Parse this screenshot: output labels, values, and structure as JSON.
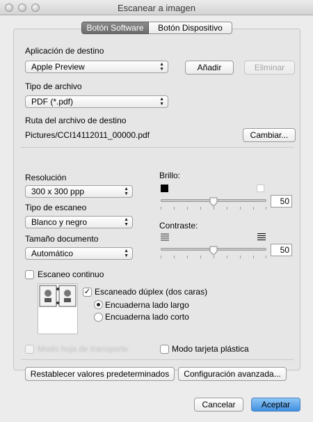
{
  "window": {
    "title": "Escanear a imagen"
  },
  "tabs": {
    "software": "Botón Software",
    "device": "Botón Dispositivo"
  },
  "destination": {
    "label": "Aplicación de destino",
    "value": "Apple Preview",
    "add_label": "Añadir",
    "remove_label": "Eliminar"
  },
  "file_type": {
    "label": "Tipo de archivo",
    "value": "PDF (*.pdf)"
  },
  "path": {
    "label": "Ruta del archivo de destino",
    "value": "Pictures/CCI14112011_00000.pdf",
    "change_label": "Cambiar..."
  },
  "resolution": {
    "label": "Resolución",
    "value": "300 x 300 ppp"
  },
  "scan_type": {
    "label": "Tipo de escaneo",
    "value": "Blanco y negro"
  },
  "doc_size": {
    "label": "Tamaño documento",
    "value": "Automático"
  },
  "brightness": {
    "label": "Brillo:",
    "value": "50",
    "level": 0.5
  },
  "contrast": {
    "label": "Contraste:",
    "value": "50",
    "level": 0.5
  },
  "continuous": {
    "label": "Escaneo continuo",
    "checked": false
  },
  "duplex": {
    "label": "Escaneado dúplex (dos caras)",
    "checked": true,
    "long_edge": "Encuaderna lado largo",
    "short_edge": "Encuaderna lado corto",
    "selected": "long_edge"
  },
  "carrier": {
    "label": "Modo hoja de transporte",
    "checked": false,
    "enabled": false
  },
  "plastic_card": {
    "label": "Modo tarjeta plástica",
    "checked": false
  },
  "footer": {
    "reset_label": "Restablecer valores predeterminados",
    "advanced_label": "Configuración avanzada...",
    "cancel_label": "Cancelar",
    "accept_label": "Aceptar"
  },
  "colors": {
    "accent": "#3f8fe0",
    "panel": "#e6e6e6"
  }
}
